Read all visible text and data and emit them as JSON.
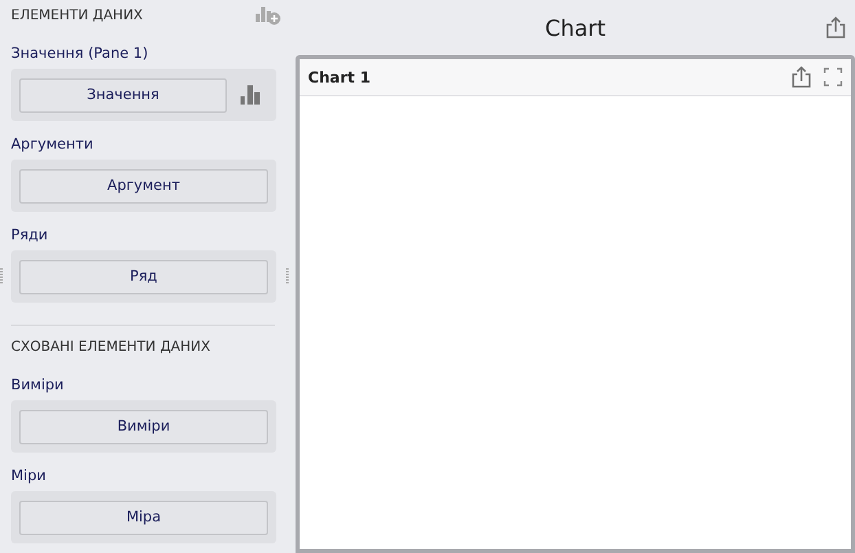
{
  "data_items": {
    "title": "ЕЛЕМЕНТИ ДАНИХ",
    "groups": [
      {
        "label": "Значення (Pane 1)",
        "button": "Значення",
        "kind": "series"
      },
      {
        "label": "Аргументи",
        "button": "Аргумент",
        "kind": "plain"
      },
      {
        "label": "Ряди",
        "button": "Ряд",
        "kind": "grip"
      }
    ]
  },
  "hidden_items": {
    "title": "СХОВАНІ ЕЛЕМЕНТИ ДАНИХ",
    "groups": [
      {
        "label": "Виміри",
        "button": "Виміри",
        "kind": "plain"
      },
      {
        "label": "Міри",
        "button": "Міра",
        "kind": "plain"
      }
    ]
  },
  "dashboard": {
    "title": "Chart"
  },
  "item": {
    "title": "Chart 1"
  }
}
